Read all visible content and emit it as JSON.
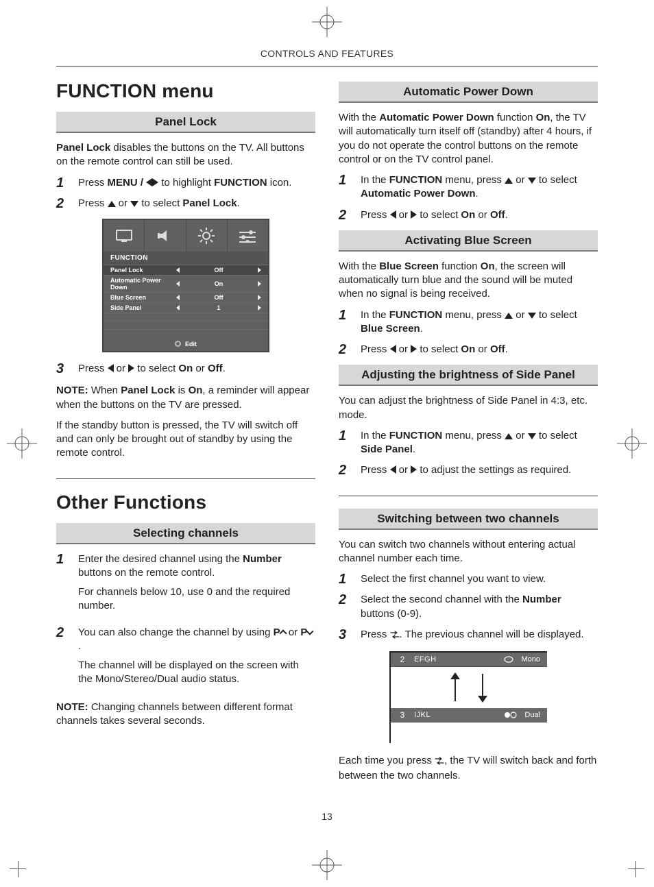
{
  "running_head": "CONTROLS AND FEATURES",
  "page_number": "13",
  "left": {
    "h1": "FUNCTION menu",
    "sub1": "Panel Lock",
    "intro_pre": "Panel Lock",
    "intro_post": " disables the buttons on the TV. All buttons on the remote control can still be used.",
    "s1_pre": "Press ",
    "s1_menu": "MENU / ",
    "s1_mid": " to highlight ",
    "s1_func": "FUNCTION",
    "s1_post": " icon.",
    "s2_pre": "Press ",
    "s2_mid": " or ",
    "s2_sel": " to select ",
    "s2_pl": "Panel Lock",
    "s2_post": ".",
    "s3_pre": "Press ",
    "s3_or": " or ",
    "s3_sel": " to select ",
    "s3_on": "On",
    "s3_oor": " or ",
    "s3_off": "Off",
    "s3_post": ".",
    "note_label": "NOTE:",
    "note_1a": " When ",
    "note_1b": "Panel Lock",
    "note_1c": " is ",
    "note_1d": "On",
    "note_1e": ", a reminder will appear when the buttons on the TV are pressed.",
    "note_2": "If the standby button is pressed, the TV will switch off and can only be brought out of standby by using the remote control.",
    "h1b": "Other Functions",
    "sub2": "Selecting channels",
    "b_s1_a": "Enter the desired channel using the ",
    "b_s1_b": "Number",
    "b_s1_c": " buttons on the remote control.",
    "b_s1_p2": "For channels below 10, use 0 and the required number.",
    "b_s2_a": "You can also change the channel by using ",
    "b_s2_p": "P",
    "b_s2_or": " or ",
    "b_s2_post": ".",
    "b_s2_p2": "The channel will be displayed on the screen with the Mono/Stereo/Dual audio status.",
    "b_note_label": "NOTE:",
    "b_note": " Changing channels between different format channels takes several seconds."
  },
  "osd": {
    "title": "FUNCTION",
    "rows": [
      {
        "name": "Panel Lock",
        "val": "Off",
        "hi": true
      },
      {
        "name": "Automatic Power Down",
        "val": "On"
      },
      {
        "name": "Blue Screen",
        "val": "Off"
      },
      {
        "name": "Side Panel",
        "val": "1"
      }
    ],
    "foot": "Edit"
  },
  "right": {
    "apd_title": "Automatic Power Down",
    "apd_p_a": "With the ",
    "apd_p_b": "Automatic Power Down",
    "apd_p_c": " function ",
    "apd_p_d": "On",
    "apd_p_e": ", the TV will automatically turn itself off (standby) after 4 hours, if you do not operate the control buttons on the remote control or on the TV control panel.",
    "apd_s1_a": "In the ",
    "apd_s1_b": "FUNCTION",
    "apd_s1_c": " menu, press ",
    "apd_s1_or": " or ",
    "apd_s1_d": " to select ",
    "apd_s1_e": "Automatic Power Down",
    "apd_s1_f": ".",
    "apd_s2_a": "Press ",
    "apd_s2_or": " or ",
    "apd_s2_b": " to select ",
    "apd_s2_on": "On",
    "apd_s2_oor": " or ",
    "apd_s2_off": "Off",
    "apd_s2_c": ".",
    "bs_title": "Activating Blue Screen",
    "bs_p_a": "With the ",
    "bs_p_b": "Blue Screen",
    "bs_p_c": " function ",
    "bs_p_d": "On",
    "bs_p_e": ", the screen will automatically turn blue and the sound will be muted when no signal is being received.",
    "bs_s1_a": "In the ",
    "bs_s1_b": "FUNCTION",
    "bs_s1_c": " menu, press ",
    "bs_s1_or": " or ",
    "bs_s1_d": " to select ",
    "bs_s1_e": "Blue Screen",
    "bs_s1_f": ".",
    "bs_s2_a": "Press ",
    "bs_s2_or": " or ",
    "bs_s2_b": " to select ",
    "bs_s2_on": "On",
    "bs_s2_oor": " or ",
    "bs_s2_off": "Off",
    "bs_s2_c": ".",
    "sp_title": "Adjusting the brightness of Side Panel",
    "sp_p": "You can adjust the brightness of Side Panel in 4:3, etc. mode.",
    "sp_s1_a": "In the ",
    "sp_s1_b": "FUNCTION",
    "sp_s1_c": " menu, press ",
    "sp_s1_or": " or ",
    "sp_s1_d": " to select ",
    "sp_s1_e": "Side Panel",
    "sp_s1_f": ".",
    "sp_s2_a": "Press ",
    "sp_s2_or": " or ",
    "sp_s2_b": " to adjust the settings as required.",
    "sw_title": "Switching between two channels",
    "sw_p": "You can switch two channels without entering actual channel number each time.",
    "sw_s1": "Select the first channel you want to view.",
    "sw_s2_a": "Select the second channel with the ",
    "sw_s2_b": "Number",
    "sw_s2_c": " buttons (0-9).",
    "sw_s3_a": "Press ",
    "sw_s3_b": ". The previous channel will be displayed.",
    "sw_tail_a": "Each time you press ",
    "sw_tail_b": ", the TV will switch back and forth between the two channels."
  },
  "chfig": {
    "top_num": "2",
    "top_name": "EFGH",
    "top_aud": "Mono",
    "bot_num": "3",
    "bot_name": "IJKL",
    "bot_aud": "Dual"
  }
}
